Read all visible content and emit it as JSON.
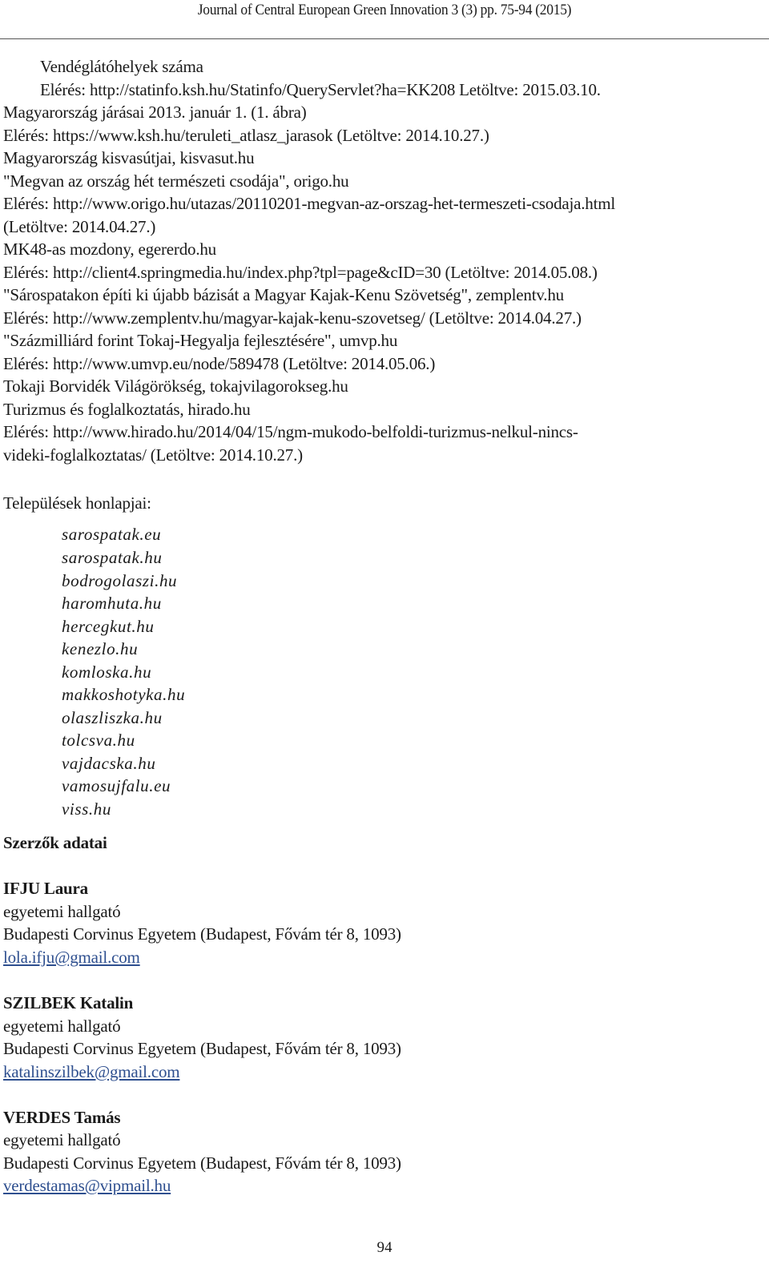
{
  "header": {
    "journal": "Journal of Central European Green Innovation 3 (3) pp. 75-94 (2015)"
  },
  "references": [
    "Vendéglátóhelyek száma",
    "Elérés: http://statinfo.ksh.hu/Statinfo/QueryServlet?ha=KK208 Letöltve: 2015.03.10.",
    "Magyarország járásai 2013. január 1. (1. ábra)",
    "Elérés: https://www.ksh.hu/teruleti_atlasz_jarasok (Letöltve: 2014.10.27.)",
    "Magyarország kisvasútjai, kisvasut.hu",
    "\"Megvan az ország hét természeti csodája\", origo.hu",
    "Elérés: http://www.origo.hu/utazas/20110201-megvan-az-orszag-het-termeszeti-csodaja.html",
    "(Letöltve: 2014.04.27.)",
    "MK48-as mozdony, egererdo.hu",
    "Elérés: http://client4.springmedia.hu/index.php?tpl=page&cID=30 (Letöltve: 2014.05.08.)",
    "\"Sárospatakon építi ki újabb bázisát a Magyar Kajak-Kenu Szövetség\", zemplentv.hu",
    "Elérés: http://www.zemplentv.hu/magyar-kajak-kenu-szovetseg/ (Letöltve: 2014.04.27.)",
    "\"Százmilliárd forint Tokaj-Hegyalja fejlesztésére\", umvp.hu",
    "Elérés: http://www.umvp.eu/node/589478 (Letöltve: 2014.05.06.)",
    "Tokaji Borvidék Világörökség, tokajvilagorokseg.hu",
    "Turizmus és foglalkoztatás, hirado.hu",
    "Elérés: http://www.hirado.hu/2014/04/15/ngm-mukodo-belfoldi-turizmus-nelkul-nincs-",
    "videki-foglalkoztatas/ (Letöltve: 2014.10.27.)"
  ],
  "websites": {
    "heading": "Települések honlapjai:",
    "items": [
      "sarospatak.eu",
      "sarospatak.hu",
      "bodrogolaszi.hu",
      "haromhuta.hu",
      "hercegkut.hu",
      "kenezlo.hu",
      "komloska.hu",
      "makkoshotyka.hu",
      "olaszliszka.hu",
      "tolcsva.hu",
      "vajdacska.hu",
      "vamosujfalu.eu",
      "viss.hu"
    ]
  },
  "authors": {
    "heading": "Szerzők adatai",
    "list": [
      {
        "name": "IFJU Laura",
        "role": "egyetemi hallgató",
        "affiliation": "Budapesti Corvinus Egyetem (Budapest, Fővám tér 8, 1093)",
        "email": "lola.ifju@gmail.com"
      },
      {
        "name": "SZILBEK Katalin",
        "role": "egyetemi hallgató",
        "affiliation": "Budapesti Corvinus Egyetem (Budapest, Fővám tér 8, 1093)",
        "email": "katalinszilbek@gmail.com"
      },
      {
        "name": "VERDES Tamás",
        "role": "egyetemi hallgató",
        "affiliation": "Budapesti Corvinus Egyetem (Budapest, Fővám tér 8, 1093)",
        "email": "verdestamas@vipmail.hu"
      }
    ]
  },
  "page_number": "94",
  "colors": {
    "link": "#2e4f8f",
    "text": "#1a1a1a"
  }
}
